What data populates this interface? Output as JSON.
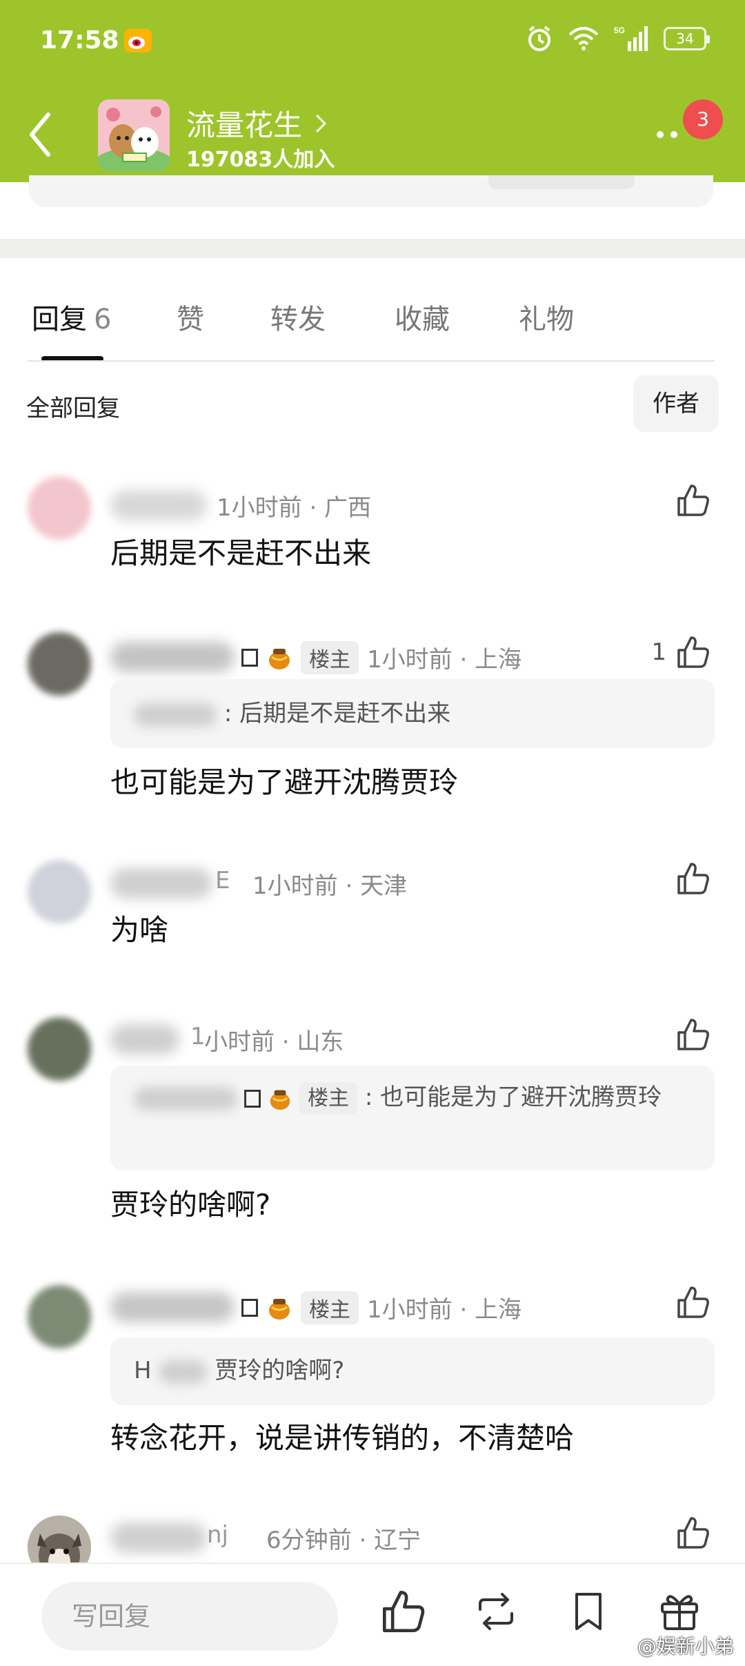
{
  "status_bar": {
    "time": "17:58",
    "battery": "34",
    "network": "5G"
  },
  "header": {
    "group_name": "流量花生",
    "members": "197083人加入",
    "notification_count": "3"
  },
  "tabs": [
    {
      "label": "回复",
      "count": "6"
    },
    {
      "label": "赞"
    },
    {
      "label": "转发"
    },
    {
      "label": "收藏"
    },
    {
      "label": "礼物"
    }
  ],
  "filter": {
    "all_label": "全部回复",
    "author_label": "作者"
  },
  "comments": [
    {
      "meta": "1小时前 · 广西",
      "text": "后期是不是赶不出来",
      "likes": ""
    },
    {
      "name_tail": "",
      "lz_tag": "楼主",
      "meta": "1小时前 · 上海",
      "quote": ": 后期是不是赶不出来",
      "text": "也可能是为了避开沈腾贾玲",
      "likes": "1"
    },
    {
      "name_tail": "E",
      "meta": "1小时前 · 天津",
      "text": "为啥",
      "likes": ""
    },
    {
      "name_tail": "1",
      "meta": "小时前 · 山东",
      "quote_lz_tag": "楼主",
      "quote": ": 也可能是为了避开沈腾贾玲",
      "text": "贾玲的啥啊?",
      "likes": ""
    },
    {
      "lz_tag": "楼主",
      "meta": "1小时前 · 上海",
      "quote_head": "H",
      "quote": "贾玲的啥啊?",
      "text": "转念花开，说是讲传销的，不清楚哈",
      "likes": ""
    },
    {
      "name_tail": "nj",
      "meta": "6分钟前 · 辽宁",
      "likes": ""
    }
  ],
  "bottom_bar": {
    "reply_placeholder": "写回复"
  },
  "watermark": "@娱新小弟",
  "colors": {
    "brand_green": "#9dc52b",
    "badge_red": "#f04e4e"
  },
  "icons": [
    "back-icon",
    "chevron-right-icon",
    "more-icon",
    "like-icon",
    "repost-icon",
    "bookmark-icon",
    "gift-icon",
    "alarm-icon",
    "wifi-icon",
    "signal-icon",
    "weibo-icon",
    "honey-pot-icon"
  ]
}
